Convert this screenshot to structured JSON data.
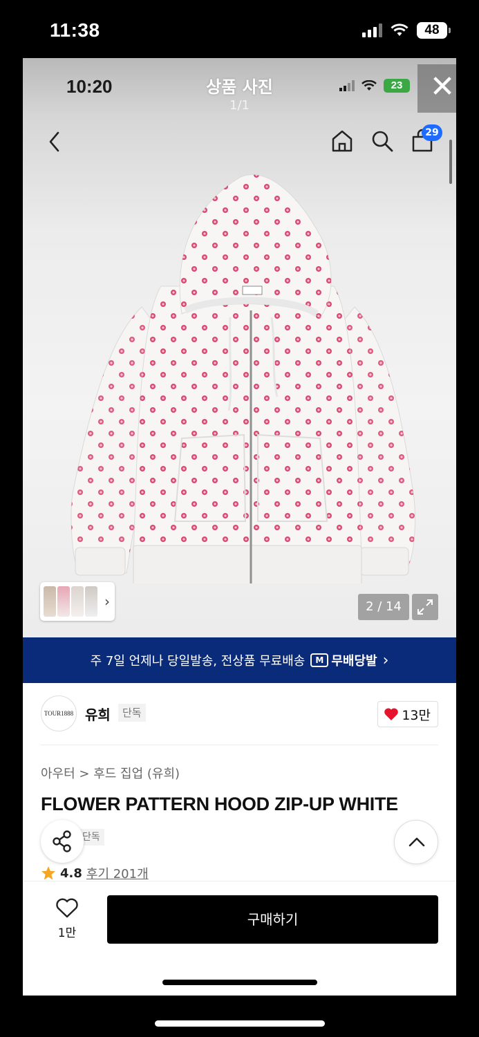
{
  "outer_status": {
    "time": "11:38",
    "battery": "48"
  },
  "viewer": {
    "time": "10:20",
    "title": "상품 사진",
    "count": "1/1",
    "battery": "23",
    "close_glyph": "✕"
  },
  "nav": {
    "cart_count": "29"
  },
  "gallery": {
    "pager": "2 / 14"
  },
  "banner": {
    "text": "주 7일 언제나 당일발송, 전상품 무료배송",
    "logo": "무배당발",
    "logo_mark": "M",
    "arrow": "›"
  },
  "brand": {
    "logo_text": "TOUR1888",
    "name": "유희",
    "tag": "단독",
    "likes": "13만"
  },
  "product": {
    "breadcrumb": "아우터 > 후드 집업 (유희)",
    "title": "FLOWER PATTERN HOOD ZIP-UP WHITE",
    "tag": "단독",
    "rating": "4.8",
    "reviews": "후기 201개"
  },
  "bottom": {
    "wish_count": "1만",
    "buy_label": "구매하기"
  },
  "colors": {
    "banner": "#0a2a7a",
    "buy_button": "#000000",
    "badge": "#1e6cff",
    "heart": "#e5132c",
    "star": "#f5a623",
    "battery_green": "#3aa844"
  }
}
